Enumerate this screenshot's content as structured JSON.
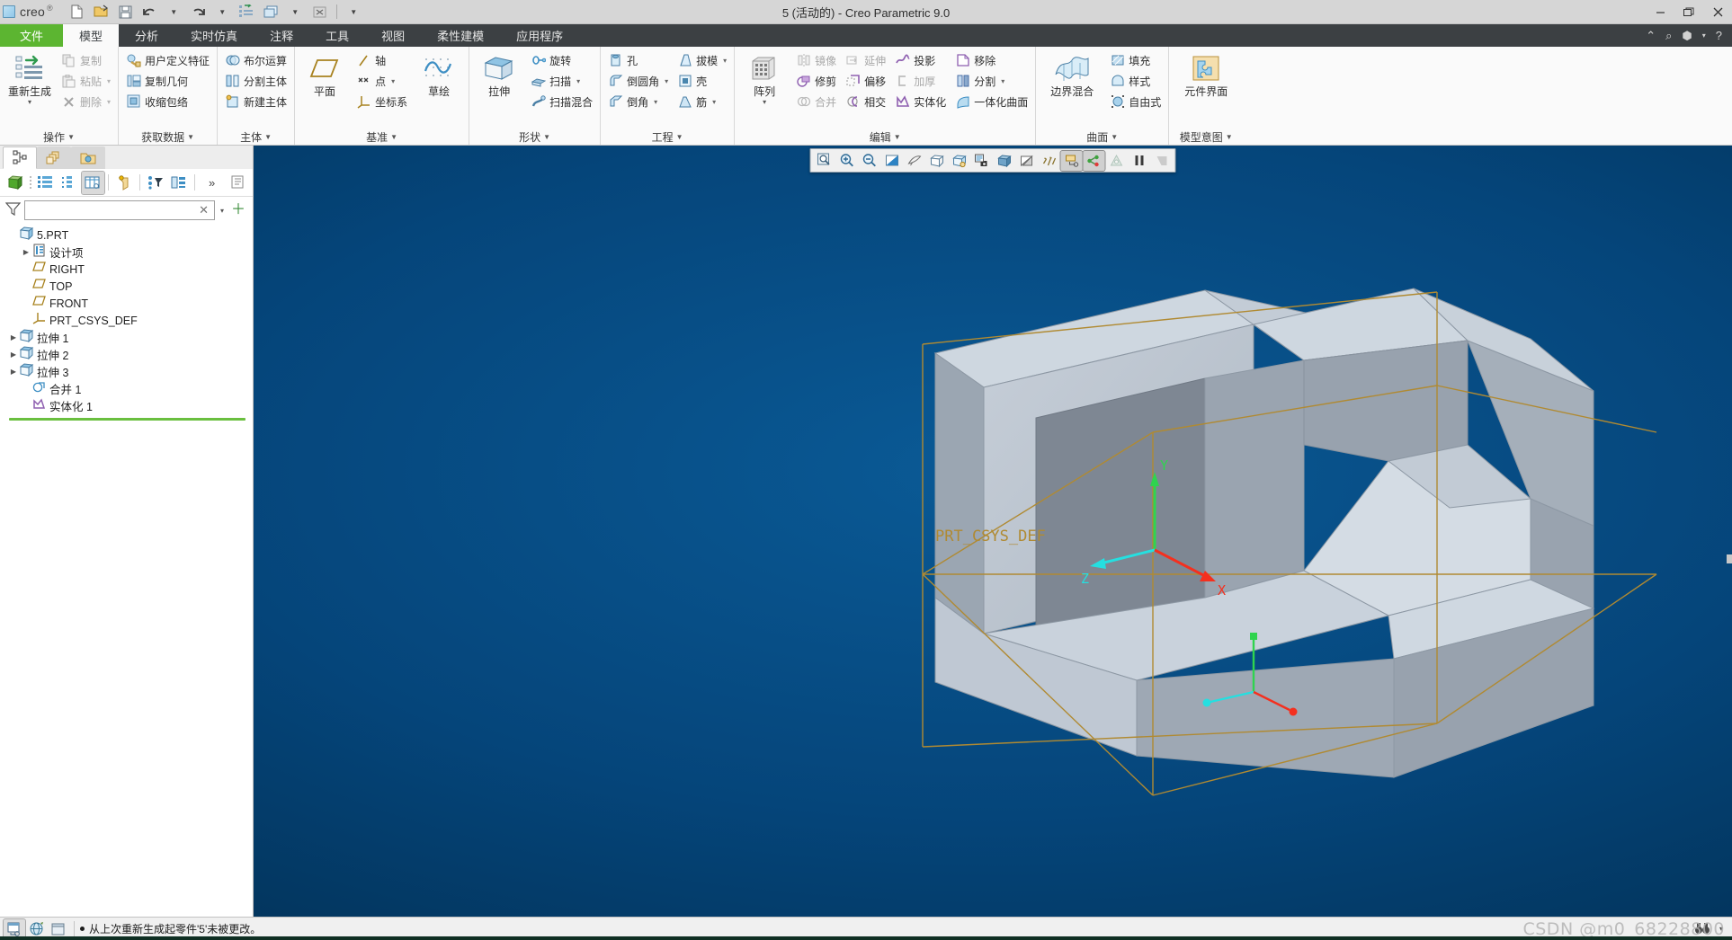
{
  "window": {
    "title": "5 (活动的) - Creo Parametric 9.0",
    "app_brand": "creo",
    "minimize": "—",
    "maximize": "❐",
    "close": "✕"
  },
  "quick_access": [
    {
      "name": "new-file",
      "icon": "new-document-icon"
    },
    {
      "name": "open-file",
      "icon": "open-folder-icon"
    },
    {
      "name": "save-file",
      "icon": "save-disk-icon"
    },
    {
      "name": "undo",
      "icon": "undo-arrow-icon"
    },
    {
      "name": "undo-dropdown",
      "icon": "chevron-down-icon"
    },
    {
      "name": "redo",
      "icon": "redo-arrow-icon"
    },
    {
      "name": "redo-dropdown",
      "icon": "chevron-down-icon"
    },
    {
      "name": "regenerate",
      "icon": "regenerate-icon"
    },
    {
      "name": "window-switch",
      "icon": "windows-icon"
    },
    {
      "name": "window-dropdown",
      "icon": "chevron-down-icon"
    },
    {
      "name": "close-window",
      "icon": "close-box-icon"
    },
    {
      "name": "customize-qat",
      "icon": "chevron-down-icon"
    }
  ],
  "tabs": [
    {
      "label": "文件",
      "kind": "file"
    },
    {
      "label": "模型",
      "kind": "active"
    },
    {
      "label": "分析",
      "kind": "normal"
    },
    {
      "label": "实时仿真",
      "kind": "normal"
    },
    {
      "label": "注释",
      "kind": "normal"
    },
    {
      "label": "工具",
      "kind": "normal"
    },
    {
      "label": "视图",
      "kind": "normal"
    },
    {
      "label": "柔性建模",
      "kind": "normal"
    },
    {
      "label": "应用程序",
      "kind": "normal"
    }
  ],
  "tabbar_right": [
    {
      "name": "collapse-ribbon-icon",
      "glyph": "⌃"
    },
    {
      "name": "search-icon",
      "glyph": "⌕"
    },
    {
      "name": "account-icon",
      "glyph": "⬢"
    },
    {
      "name": "account-dropdown-icon",
      "glyph": "▾"
    },
    {
      "name": "help-icon",
      "glyph": "?"
    }
  ],
  "ribbon": {
    "groups": [
      {
        "title": "操作",
        "big": {
          "label": "重新生成",
          "icon": "regenerate-icon",
          "caret": "▾"
        },
        "items": [
          {
            "label": "复制",
            "icon": "copy-icon",
            "disabled": true
          },
          {
            "label": "粘贴",
            "icon": "paste-icon",
            "disabled": true,
            "caret": "▾"
          },
          {
            "label": "删除",
            "icon": "delete-x-icon",
            "disabled": true,
            "caret": "▾"
          }
        ]
      },
      {
        "title": "获取数据",
        "items": [
          {
            "label": "用户定义特征",
            "icon": "udf-icon"
          },
          {
            "label": "复制几何",
            "icon": "copy-geometry-icon"
          },
          {
            "label": "收缩包络",
            "icon": "shrinkwrap-icon"
          }
        ]
      },
      {
        "title": "主体",
        "items": [
          {
            "label": "布尔运算",
            "icon": "boolean-icon"
          },
          {
            "label": "分割主体",
            "icon": "split-body-icon"
          },
          {
            "label": "新建主体",
            "icon": "new-body-icon"
          }
        ]
      },
      {
        "title": "基准",
        "big": {
          "label": "平面",
          "icon": "datum-plane-icon"
        },
        "big2": {
          "label": "草绘",
          "icon": "sketch-icon"
        },
        "items": [
          {
            "label": "轴",
            "icon": "datum-axis-icon"
          },
          {
            "label": "点",
            "icon": "datum-point-icon",
            "caret": "▾"
          },
          {
            "label": "坐标系",
            "icon": "coordinate-system-icon"
          }
        ]
      },
      {
        "title": "形状",
        "big": {
          "label": "拉伸",
          "icon": "extrude-icon"
        },
        "items": [
          {
            "label": "旋转",
            "icon": "revolve-icon"
          },
          {
            "label": "扫描",
            "icon": "sweep-icon",
            "caret": "▾"
          },
          {
            "label": "扫描混合",
            "icon": "swept-blend-icon"
          }
        ]
      },
      {
        "title": "工程",
        "items": [
          {
            "label": "孔",
            "icon": "hole-icon"
          },
          {
            "label": "倒圆角",
            "icon": "round-icon",
            "caret": "▾"
          },
          {
            "label": "倒角",
            "icon": "chamfer-icon",
            "caret": "▾"
          }
        ],
        "items2": [
          {
            "label": "拔模",
            "icon": "draft-icon",
            "caret": "▾"
          },
          {
            "label": "壳",
            "icon": "shell-icon"
          },
          {
            "label": "筋",
            "icon": "rib-icon",
            "caret": "▾"
          }
        ]
      },
      {
        "title": "编辑",
        "big": {
          "label": "阵列",
          "icon": "pattern-icon",
          "caret": "▾"
        },
        "items": [
          {
            "label": "镜像",
            "icon": "mirror-icon",
            "disabled": true
          },
          {
            "label": "修剪",
            "icon": "trim-icon"
          },
          {
            "label": "合并",
            "icon": "merge-icon",
            "disabled": true
          }
        ],
        "items2": [
          {
            "label": "延伸",
            "icon": "extend-icon",
            "disabled": true
          },
          {
            "label": "偏移",
            "icon": "offset-icon"
          },
          {
            "label": "相交",
            "icon": "intersect-icon"
          }
        ],
        "items3": [
          {
            "label": "投影",
            "icon": "project-icon"
          },
          {
            "label": "加厚",
            "icon": "thicken-icon",
            "disabled": true
          },
          {
            "label": "实体化",
            "icon": "solidify-icon"
          }
        ],
        "items4": [
          {
            "label": "移除",
            "icon": "remove-icon"
          },
          {
            "label": "分割",
            "icon": "split-surface-icon",
            "caret": "▾"
          },
          {
            "label": "一体化曲面",
            "icon": "unified-surface-icon"
          }
        ]
      },
      {
        "title": "曲面",
        "big": {
          "label": "边界混合",
          "icon": "boundary-blend-icon"
        },
        "items": [
          {
            "label": "填充",
            "icon": "fill-icon"
          },
          {
            "label": "样式",
            "icon": "style-icon"
          },
          {
            "label": "自由式",
            "icon": "freestyle-icon"
          }
        ]
      },
      {
        "title": "模型意图",
        "big": {
          "label": "元件界面",
          "icon": "component-interface-icon"
        }
      }
    ]
  },
  "navigator": {
    "tabs": [
      {
        "name": "model-tree-tab",
        "icon": "model-tree-icon",
        "state": "active"
      },
      {
        "name": "layer-tree-tab",
        "icon": "layers-icon",
        "state": "sel"
      },
      {
        "name": "folder-browser-tab",
        "icon": "folder-gear-icon",
        "state": "sel"
      }
    ],
    "toolbar": [
      {
        "name": "body-display-button",
        "icon": "green-cube-icon"
      },
      {
        "name": "tree-list-button",
        "icon": "tree-list-icon"
      },
      {
        "name": "tree-detail-button",
        "icon": "tree-detail-icon"
      },
      {
        "name": "tree-columns-button",
        "icon": "tree-columns-icon",
        "on": true
      },
      {
        "name": "tree-filter-button",
        "icon": "body-filter-icon"
      },
      {
        "name": "settings-filter-button",
        "icon": "settings-filter-icon"
      },
      {
        "name": "tree-display-button",
        "icon": "tree-display-icon"
      },
      {
        "name": "overflow-button",
        "icon": "chevrons-right-icon",
        "label": "»"
      },
      {
        "name": "notes-button",
        "icon": "notes-icon"
      }
    ],
    "filter": {
      "value": "",
      "placeholder": "",
      "clear_label": "✕",
      "dropdown_label": "▾",
      "add_label": "＋"
    },
    "tree": [
      {
        "label": "5.PRT",
        "icon": "part-icon",
        "arrow": "",
        "indent": 0
      },
      {
        "label": "设计项",
        "icon": "design-items-icon",
        "arrow": "▶",
        "indent": 1
      },
      {
        "label": "RIGHT",
        "icon": "datum-plane-icon",
        "arrow": "",
        "indent": 1
      },
      {
        "label": "TOP",
        "icon": "datum-plane-icon",
        "arrow": "",
        "indent": 1
      },
      {
        "label": "FRONT",
        "icon": "datum-plane-icon",
        "arrow": "",
        "indent": 1
      },
      {
        "label": "PRT_CSYS_DEF",
        "icon": "coordinate-system-icon",
        "arrow": "",
        "indent": 1
      },
      {
        "label": "拉伸 1",
        "icon": "extrude-feature-icon",
        "arrow": "▶",
        "indent": 1
      },
      {
        "label": "拉伸 2",
        "icon": "extrude-feature-icon",
        "arrow": "▶",
        "indent": 1
      },
      {
        "label": "拉伸 3",
        "icon": "extrude-feature-icon",
        "arrow": "▶",
        "indent": 1
      },
      {
        "label": "合并 1",
        "icon": "merge-feature-icon",
        "arrow": "",
        "indent": 1
      },
      {
        "label": "实体化 1",
        "icon": "solidify-feature-icon",
        "arrow": "",
        "indent": 1
      }
    ]
  },
  "view_toolbar": [
    {
      "name": "refit-button",
      "icon": "refit-magnifier-icon"
    },
    {
      "name": "zoom-in-button",
      "icon": "zoom-in-icon"
    },
    {
      "name": "zoom-out-button",
      "icon": "zoom-out-icon"
    },
    {
      "name": "repaint-button",
      "icon": "repaint-icon"
    },
    {
      "name": "spin-center-button",
      "icon": "spin-center-icon"
    },
    {
      "name": "saved-orientations-button",
      "icon": "saved-view-cube-icon"
    },
    {
      "name": "view-manager-button",
      "icon": "view-manager-icon"
    },
    {
      "name": "capture-image-button",
      "icon": "camera-icon"
    },
    {
      "name": "display-style-button",
      "icon": "shaded-cube-icon"
    },
    {
      "name": "appearance-gallery-button",
      "icon": "appearance-icon"
    },
    {
      "name": "annotation-display-button",
      "icon": "annotation-display-icon"
    },
    {
      "name": "datum-display-button",
      "icon": "datum-display-icon",
      "on": true
    },
    {
      "name": "point-display-button",
      "icon": "point-display-icon",
      "on": true
    },
    {
      "name": "layer-visibility-button",
      "icon": "layer-visibility-icon",
      "disabled": true
    },
    {
      "name": "pause-button",
      "icon": "pause-icon",
      "disabled": false
    },
    {
      "name": "stop-button",
      "icon": "stop-icon",
      "disabled": true
    }
  ],
  "graphics": {
    "csys_label": "PRT_CSYS_DEF",
    "axis_x": "X",
    "axis_y": "Y",
    "axis_z": "Z",
    "bg_color": "#04457a",
    "body_color": "#c3ccd6",
    "datum_color": "#b08a32"
  },
  "statusbar": {
    "buttons": [
      {
        "name": "selection-filter-button",
        "icon": "selection-filter-icon",
        "on": true
      },
      {
        "name": "globe-button",
        "icon": "globe-icon"
      },
      {
        "name": "window-button",
        "icon": "window-icon"
      }
    ],
    "message": "从上次重新生成起零件'5'未被更改。",
    "search_button": {
      "name": "find-button",
      "icon": "binoculars-icon",
      "caret": "▾"
    }
  },
  "watermark": "CSDN @m0_68228800"
}
